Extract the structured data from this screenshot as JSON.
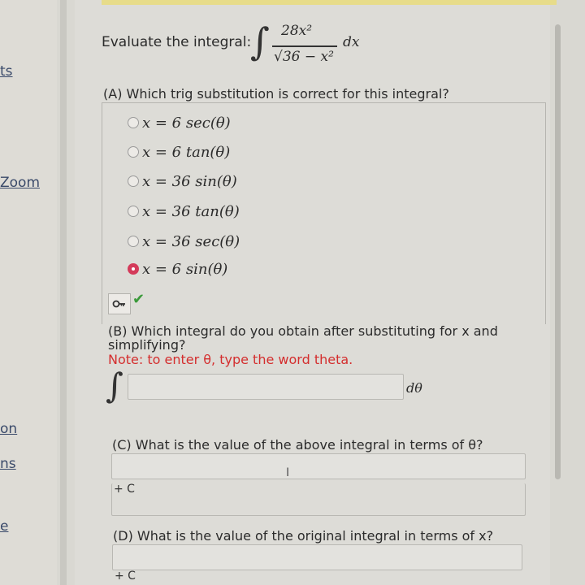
{
  "sidebar": {
    "links": [
      "ts",
      "Zoom",
      "on",
      "ns",
      "e"
    ]
  },
  "problem": {
    "prompt": "Evaluate the integral:",
    "numerator": "28x²",
    "denominator": "√36 − x²",
    "differential": "dx"
  },
  "part_a": {
    "question": "(A) Which trig substitution is correct for this integral?",
    "choices": [
      {
        "label": "x = 6 sec(θ)",
        "selected": false
      },
      {
        "label": "x = 6 tan(θ)",
        "selected": false
      },
      {
        "label": "x = 36 sin(θ)",
        "selected": false
      },
      {
        "label": "x = 36 tan(θ)",
        "selected": false
      },
      {
        "label": "x = 36 sec(θ)",
        "selected": false
      },
      {
        "label": "x = 6 sin(θ)",
        "selected": true
      }
    ],
    "status_icon": "check-icon"
  },
  "part_b": {
    "question_line1": "(B) Which integral do you obtain after substituting for x and",
    "question_line2": "simplifying?",
    "note": "Note: to enter θ, type the word theta.",
    "answer_value": "",
    "differential": "dθ"
  },
  "part_c": {
    "question": "(C) What is the value of the above integral in terms of θ?",
    "answer_value": "",
    "constant": "+ C"
  },
  "part_d": {
    "question": "(D) What is the value of the original integral in terms of x?",
    "answer_value": "",
    "constant": "+ C"
  },
  "colors": {
    "selected_radio": "#d43b5a",
    "correct_check": "#3a9a3a",
    "note_text": "#d42e2e"
  }
}
